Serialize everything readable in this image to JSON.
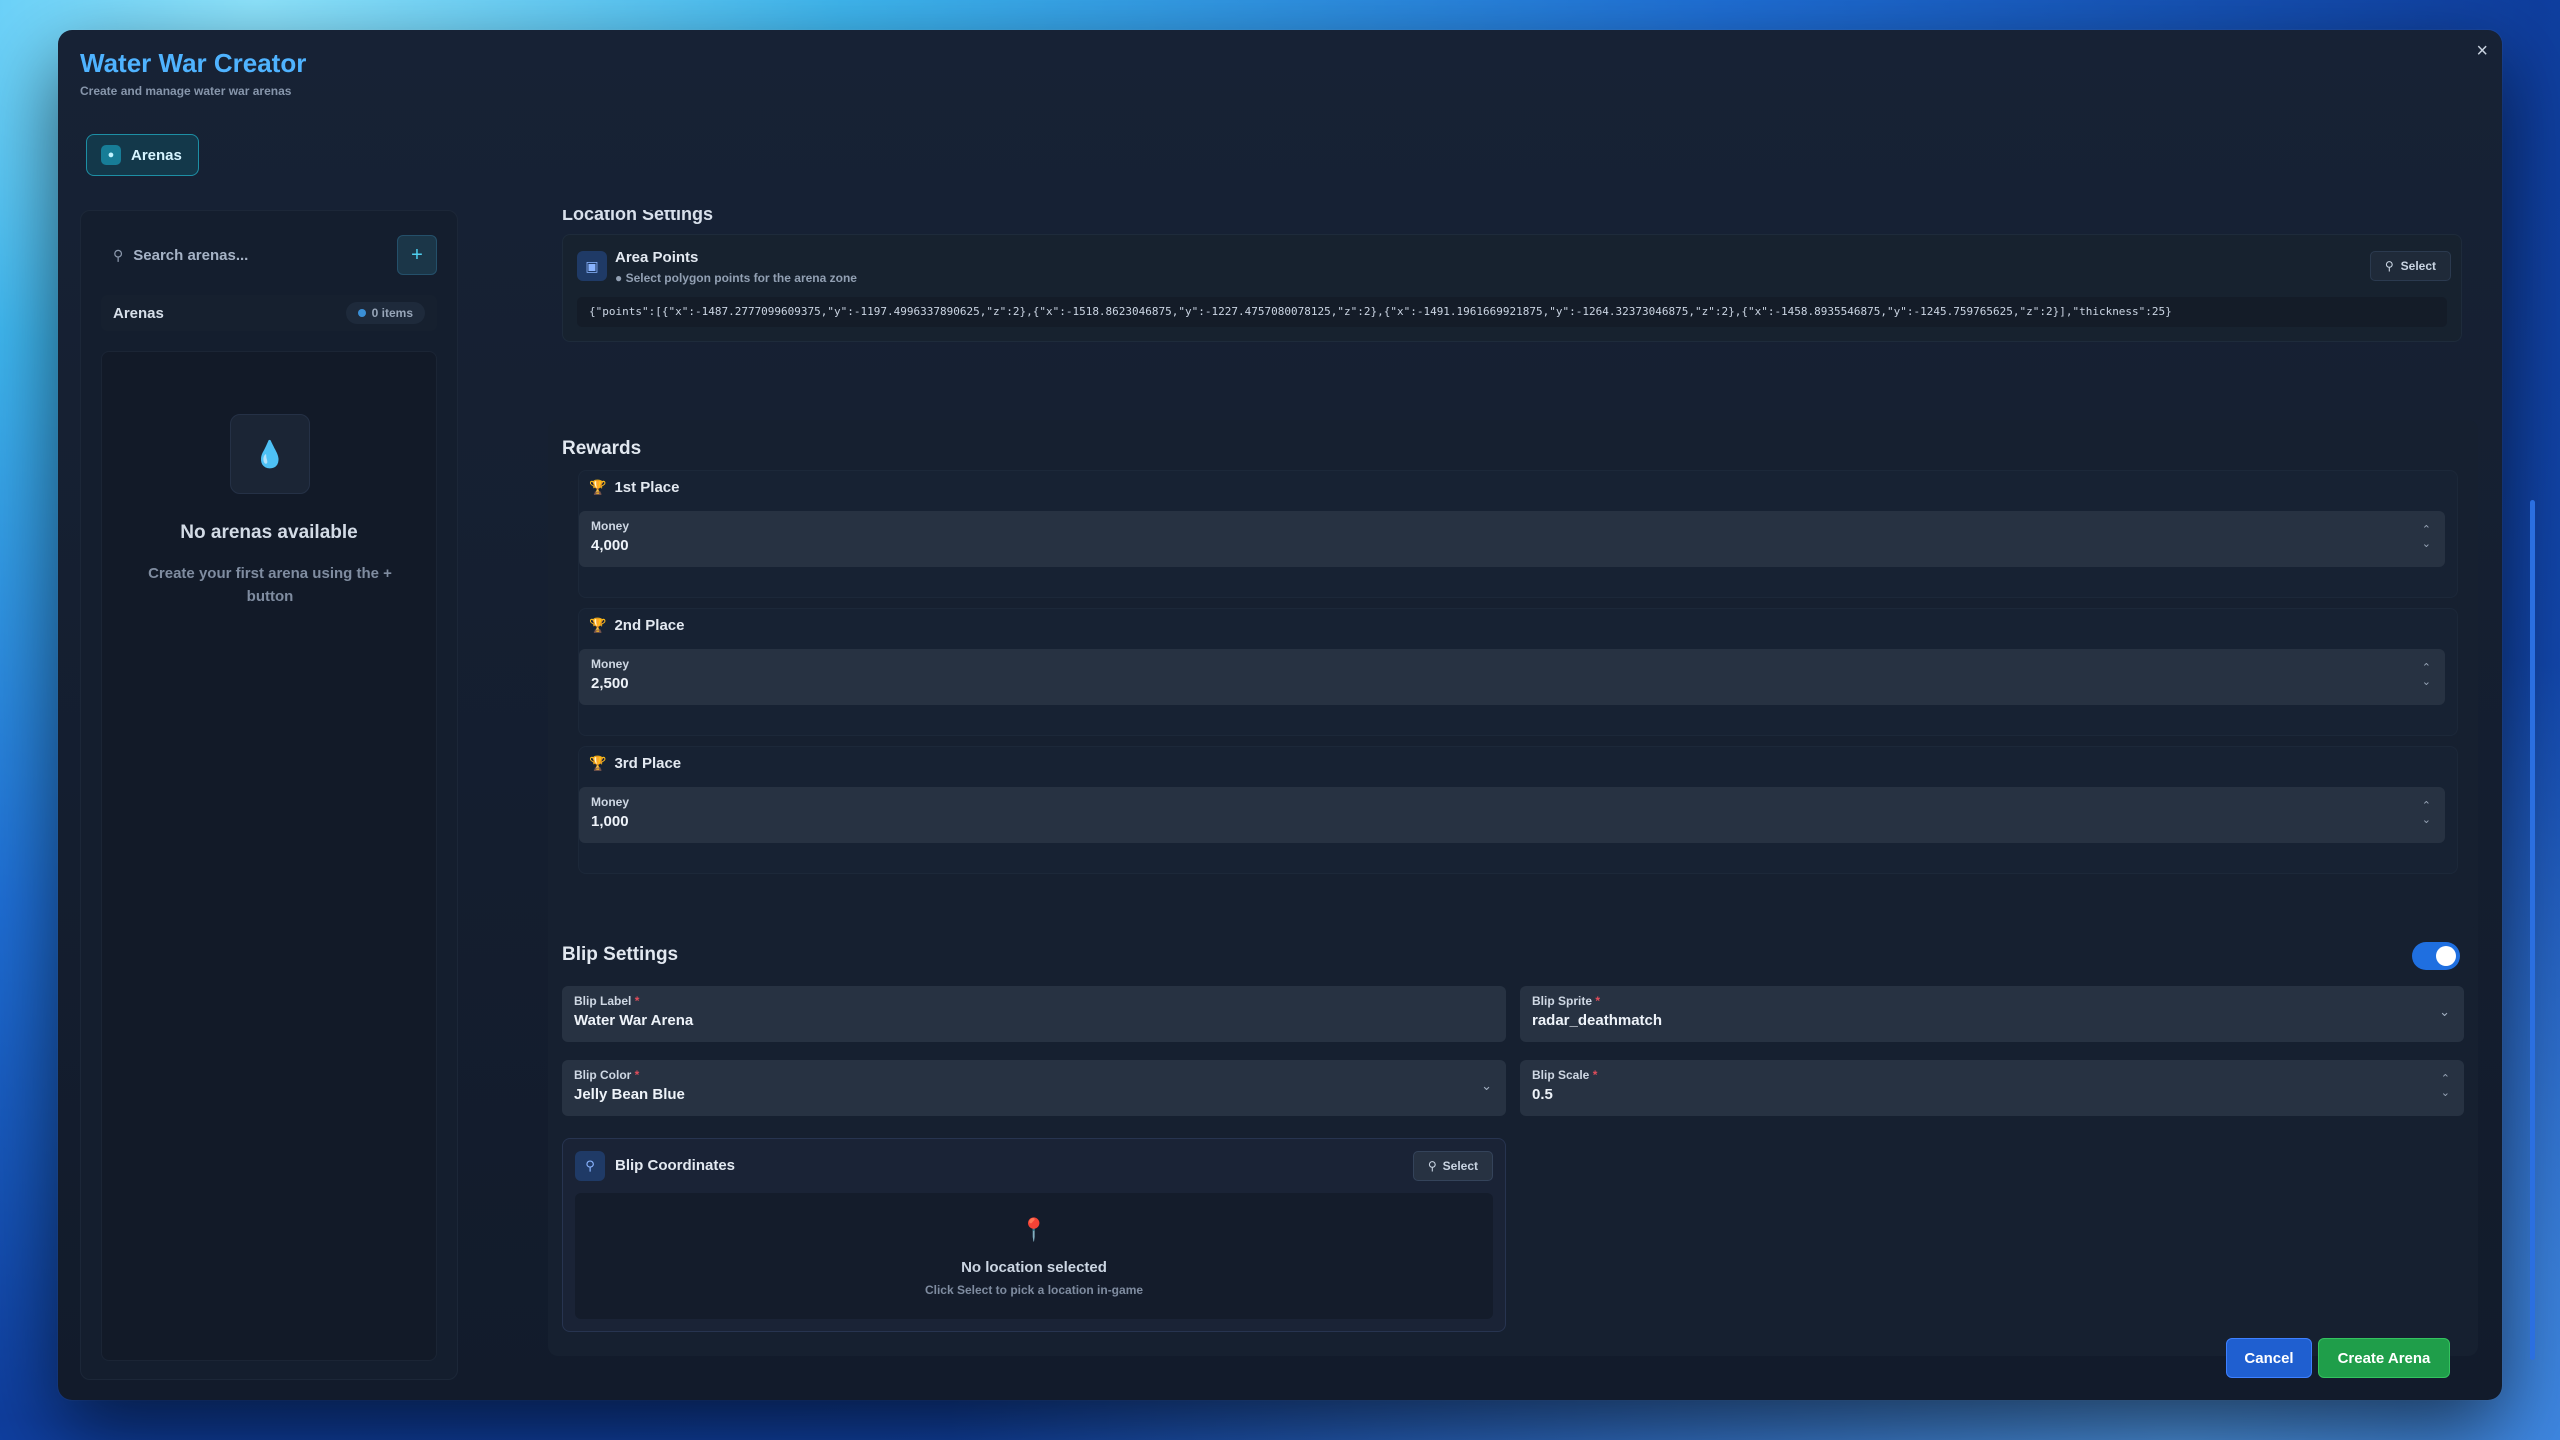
{
  "app": {
    "title": "Water War Creator",
    "subtitle": "Create and manage water war arenas",
    "close_glyph": "×"
  },
  "tabs": [
    {
      "label": "Arenas",
      "icon": "droplet-icon",
      "active": true
    }
  ],
  "sidebar": {
    "search_placeholder": "Search arenas...",
    "add_glyph": "+",
    "list_heading": "Arenas",
    "count_badge": "0 items",
    "empty_title": "No arenas available",
    "empty_desc": "Create your first arena using the + button"
  },
  "location": {
    "section_title": "Location Settings",
    "area_points": {
      "title": "Area Points",
      "subtitle": "Select polygon points for the arena zone",
      "select_label": "Select",
      "value": "{\"points\":[{\"x\":-1487.2777099609375,\"y\":-1197.4996337890625,\"z\":2},{\"x\":-1518.8623046875,\"y\":-1227.4757080078125,\"z\":2},{\"x\":-1491.1961669921875,\"y\":-1264.32373046875,\"z\":2},{\"x\":-1458.8935546875,\"y\":-1245.759765625,\"z\":2}],\"thickness\":25}"
    }
  },
  "rewards": {
    "section_title": "Rewards",
    "places": [
      {
        "title": "1st Place",
        "field_label": "Money",
        "value": "4,000",
        "trophy_color": "#e6b422"
      },
      {
        "title": "2nd Place",
        "field_label": "Money",
        "value": "2,500",
        "trophy_color": "#c7ced9"
      },
      {
        "title": "3rd Place",
        "field_label": "Money",
        "value": "1,000",
        "trophy_color": "#d98a3a"
      }
    ]
  },
  "blip": {
    "section_title": "Blip Settings",
    "enabled": true,
    "label": {
      "label": "Blip Label",
      "value": "Water War Arena"
    },
    "sprite": {
      "label": "Blip Sprite",
      "value": "radar_deathmatch"
    },
    "color": {
      "label": "Blip Color",
      "value": "Jelly Bean Blue"
    },
    "scale": {
      "label": "Blip Scale",
      "value": "0.5"
    },
    "coordinates": {
      "title": "Blip Coordinates",
      "select_label": "Select",
      "empty_title": "No location selected",
      "empty_sub": "Click Select to pick a location in-game"
    }
  },
  "footer": {
    "cancel_label": "Cancel",
    "create_label": "Create Arena"
  },
  "colors": {
    "accent": "#4fb3ff",
    "primary_button": "#1f5fd0",
    "success_button": "#1f9e4a",
    "toggle_on": "#1f6fe0"
  }
}
